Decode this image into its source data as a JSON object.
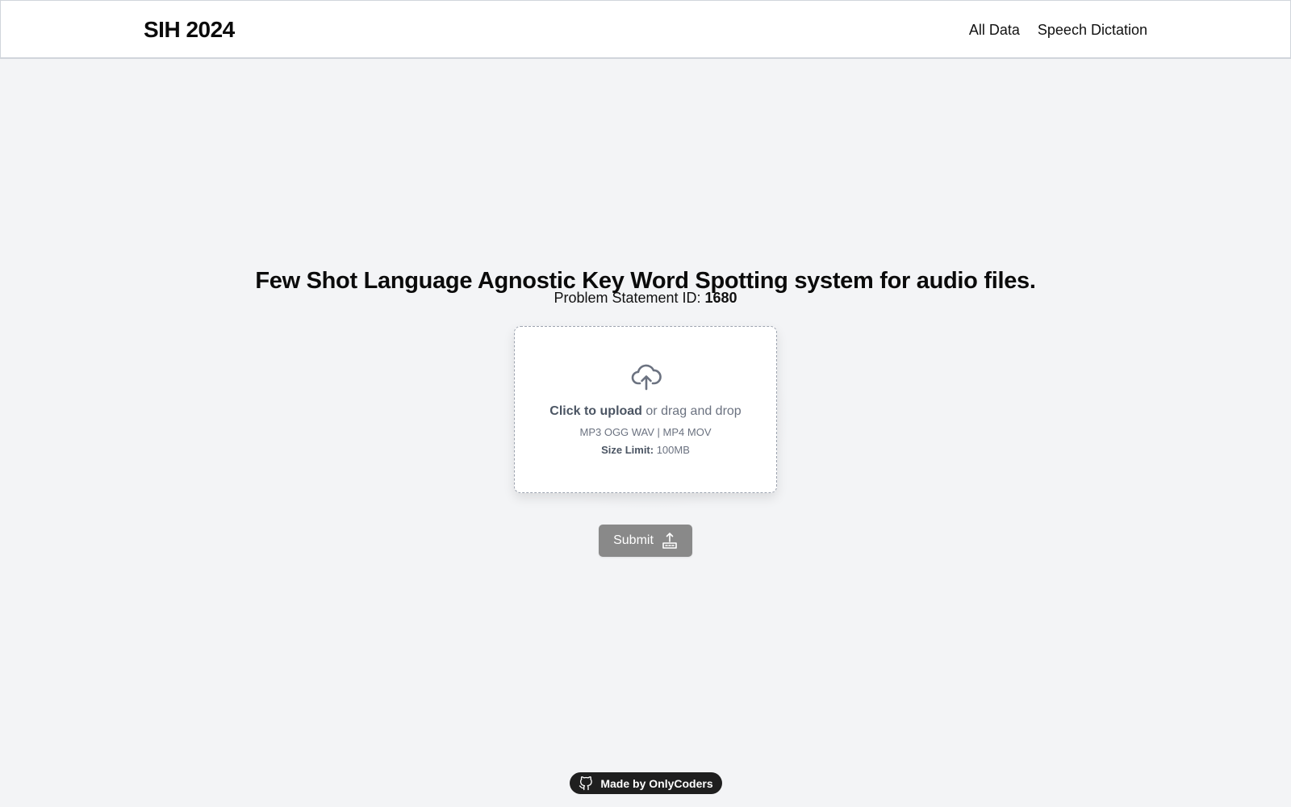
{
  "header": {
    "brand": "SIH 2024",
    "nav": [
      {
        "label": "All Data"
      },
      {
        "label": "Speech Dictation"
      }
    ]
  },
  "main": {
    "title": "Few Shot Language Agnostic Key Word Spotting system for audio files.",
    "problem_label": "Problem Statement ID: ",
    "problem_id": "1680",
    "upload": {
      "icon": "cloud-upload-icon",
      "click_text": "Click to upload",
      "drag_text": " or drag and drop",
      "formats": "MP3 OGG WAV | MP4 MOV",
      "limit_label": "Size Limit:",
      "limit_value": " 100MB"
    },
    "submit": {
      "label": "Submit",
      "icon": "upload-tray-icon"
    }
  },
  "footer": {
    "icon": "github-icon",
    "label": "Made by OnlyCoders"
  },
  "colors": {
    "page_background": "#f3f4f6",
    "submit_background": "#898989",
    "footer_badge": "#1f1f1f"
  }
}
